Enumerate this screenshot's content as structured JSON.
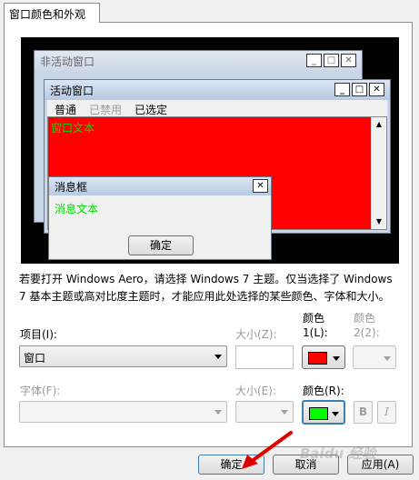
{
  "tab": {
    "label": "窗口颜色和外观"
  },
  "preview": {
    "inactive_window": {
      "title": "非活动窗口",
      "min": "_",
      "max": "□",
      "close": "✕"
    },
    "active_window": {
      "title": "活动窗口",
      "min": "_",
      "max": "□",
      "close": "✕",
      "menu": [
        "普通",
        "已禁用",
        "已选定"
      ],
      "body_text": "窗口文本"
    },
    "message_box": {
      "title": "消息框",
      "close": "✕",
      "text": "消息文本",
      "ok_label": "确定"
    }
  },
  "description": "若要打开 Windows Aero，请选择 Windows 7 主题。仅当选择了 Windows 7 基本主题或高对比度主题时，才能应用此处选择的某些颜色、字体和大小。",
  "form": {
    "item_label": "项目(I):",
    "item_value": "窗口",
    "size_label": "大小(Z):",
    "color1_label_line1": "颜色",
    "color1_label_line2": "1(L):",
    "color2_label_line1": "颜色",
    "color2_label_line2": "2(2):",
    "font_label": "字体(F):",
    "size2_label": "大小(E):",
    "color_label": "颜色(R):",
    "bold_label": "B",
    "italic_label": "I"
  },
  "colors": {
    "color1": "#ff0000",
    "font_color": "#00ff00",
    "window_bg": "#ff0000",
    "window_text": "#00cc00"
  },
  "footer": {
    "ok_label": "确定",
    "cancel_label": "取消",
    "apply_label": "应用(A)"
  },
  "watermark": "Baidu 经验"
}
